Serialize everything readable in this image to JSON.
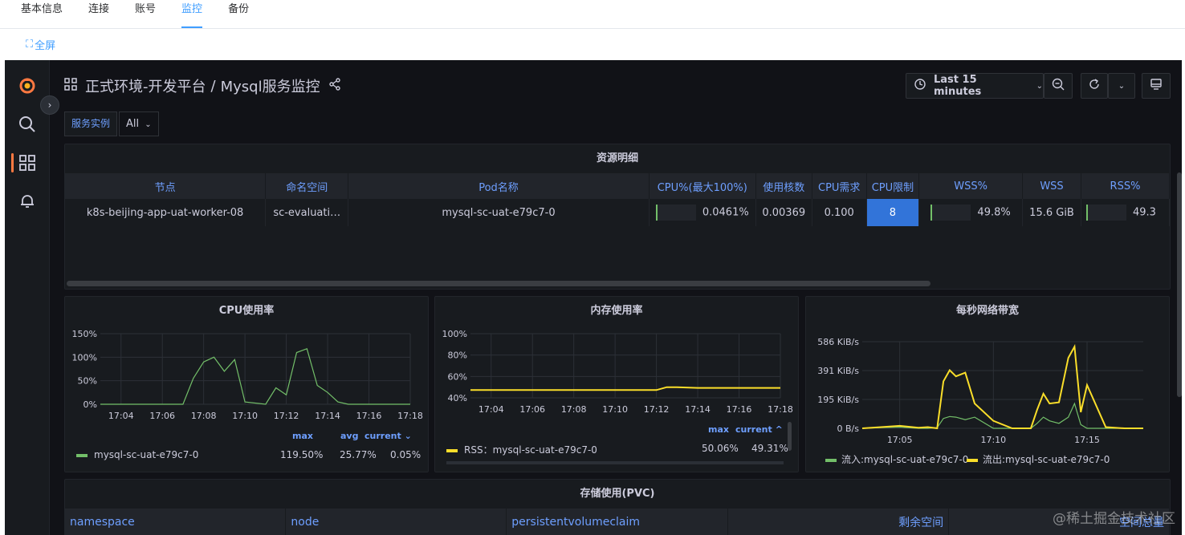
{
  "tabs": [
    "基本信息",
    "连接",
    "账号",
    "监控",
    "备份"
  ],
  "active_tab": "监控",
  "fullscreen_label": "全屏",
  "breadcrumb": {
    "folder": "正式环境-开发平台",
    "separator": "/",
    "dashboard": "Mysql服务监控"
  },
  "time_range": "Last 15 minutes",
  "variable": {
    "label": "服务实例",
    "value": "All"
  },
  "resource_panel": {
    "title": "资源明细",
    "columns": [
      "节点",
      "命名空间",
      "Pod名称",
      "CPU%(最大100%)",
      "使用核数",
      "CPU需求",
      "CPU限制",
      "WSS%",
      "WSS",
      "RSS%"
    ],
    "row": {
      "node": "k8s-beijing-app-uat-worker-08",
      "namespace": "sc-evaluati…",
      "pod": "mysql-sc-uat-e79c7-0",
      "cpu_pct": "0.0461%",
      "cores": "0.00369",
      "cpu_request": "0.100",
      "cpu_limit": "8",
      "wss_pct": "49.8%",
      "wss": "15.6 GiB",
      "rss_pct": "49.3"
    }
  },
  "cpu_panel": {
    "title": "CPU使用率",
    "legend_headers": [
      "max",
      "avg",
      "current ⌄"
    ],
    "series_name": "mysql-sc-uat-e79c7-0",
    "stats": [
      "119.50%",
      "25.77%",
      "0.05%"
    ]
  },
  "mem_panel": {
    "title": "内存使用率",
    "legend_headers": [
      "max",
      "current ^"
    ],
    "series_name": "RSS：mysql-sc-uat-e79c7-0",
    "stats": [
      "50.06%",
      "49.31%"
    ]
  },
  "net_panel": {
    "title": "每秒网络带宽",
    "legend": [
      "流入:mysql-sc-uat-e79c7-0",
      "流出:mysql-sc-uat-e79c7-0"
    ]
  },
  "pvc_panel": {
    "title": "存储使用(PVC)",
    "columns": [
      "namespace",
      "node",
      "persistentvolumeclaim",
      "剩余空间",
      "空间总量"
    ]
  },
  "watermark": "@稀土掘金技术社区",
  "colors": {
    "accent": "#409eff",
    "green": "#73bf69",
    "yellow": "#fade2a",
    "orange": "#ff9830",
    "blue": "#6e9fff"
  },
  "chart_data": [
    {
      "type": "line",
      "title": "CPU使用率",
      "x": [
        "17:03",
        "17:04",
        "17:05",
        "17:06",
        "17:07",
        "17:07:30",
        "17:08",
        "17:08:30",
        "17:09",
        "17:09:30",
        "17:10",
        "17:11",
        "17:11:30",
        "17:12",
        "17:12:30",
        "17:13",
        "17:13:30",
        "17:14",
        "17:14:30",
        "17:15",
        "17:16",
        "17:17",
        "17:18"
      ],
      "xticks": [
        "17:04",
        "17:06",
        "17:08",
        "17:10",
        "17:12",
        "17:14",
        "17:16",
        "17:18"
      ],
      "yticks": [
        "0%",
        "50%",
        "100%",
        "150%"
      ],
      "ylim": [
        0,
        150
      ],
      "series": [
        {
          "name": "mysql-sc-uat-e79c7-0",
          "color": "#73bf69",
          "values": [
            0,
            0,
            0,
            0,
            0,
            55,
            90,
            100,
            70,
            95,
            5,
            0,
            35,
            20,
            110,
            118,
            40,
            25,
            5,
            0,
            0,
            0,
            0
          ]
        }
      ]
    },
    {
      "type": "line",
      "title": "内存使用率",
      "x": [
        "17:03",
        "17:05",
        "17:07",
        "17:09",
        "17:11",
        "17:12",
        "17:12:30",
        "17:13",
        "17:14",
        "17:15",
        "17:16",
        "17:17",
        "17:18"
      ],
      "xticks": [
        "17:04",
        "17:06",
        "17:08",
        "17:10",
        "17:12",
        "17:14",
        "17:16",
        "17:18"
      ],
      "yticks": [
        "40%",
        "60%",
        "80%",
        "100%"
      ],
      "ylim": [
        40,
        100
      ],
      "series": [
        {
          "name": "RSS：mysql-sc-uat-e79c7-0",
          "color": "#fade2a",
          "values": [
            47.3,
            47.3,
            47.3,
            47.3,
            47.3,
            47.3,
            50.0,
            50.0,
            49.3,
            49.3,
            49.3,
            49.3,
            49.3
          ]
        }
      ]
    },
    {
      "type": "line",
      "title": "每秒网络带宽",
      "x": [
        "17:03",
        "17:04",
        "17:05",
        "17:06",
        "17:06:30",
        "17:07",
        "17:07:20",
        "17:07:40",
        "17:08",
        "17:08:30",
        "17:09",
        "17:10",
        "17:11",
        "17:12",
        "17:12:20",
        "17:12:40",
        "17:13",
        "17:13:30",
        "17:14",
        "17:14:20",
        "17:14:40",
        "17:15",
        "17:16",
        "17:17",
        "17:18"
      ],
      "xticks": [
        "17:05",
        "17:10",
        "17:15"
      ],
      "yticks": [
        "0 B/s",
        "195 KiB/s",
        "391 KiB/s",
        "586 KiB/s"
      ],
      "ylim": [
        0,
        700
      ],
      "series": [
        {
          "name": "流入:mysql-sc-uat-e79c7-0",
          "color": "#73bf69",
          "values": [
            0,
            5,
            10,
            0,
            0,
            5,
            80,
            95,
            90,
            70,
            90,
            0,
            0,
            0,
            40,
            90,
            60,
            40,
            90,
            200,
            30,
            0,
            0,
            0,
            0
          ]
        },
        {
          "name": "流出:mysql-sc-uat-e79c7-0",
          "color": "#fade2a",
          "values": [
            0,
            10,
            20,
            5,
            10,
            0,
            380,
            470,
            420,
            450,
            200,
            60,
            0,
            0,
            150,
            280,
            200,
            210,
            570,
            660,
            130,
            350,
            10,
            0,
            0
          ]
        }
      ]
    }
  ]
}
